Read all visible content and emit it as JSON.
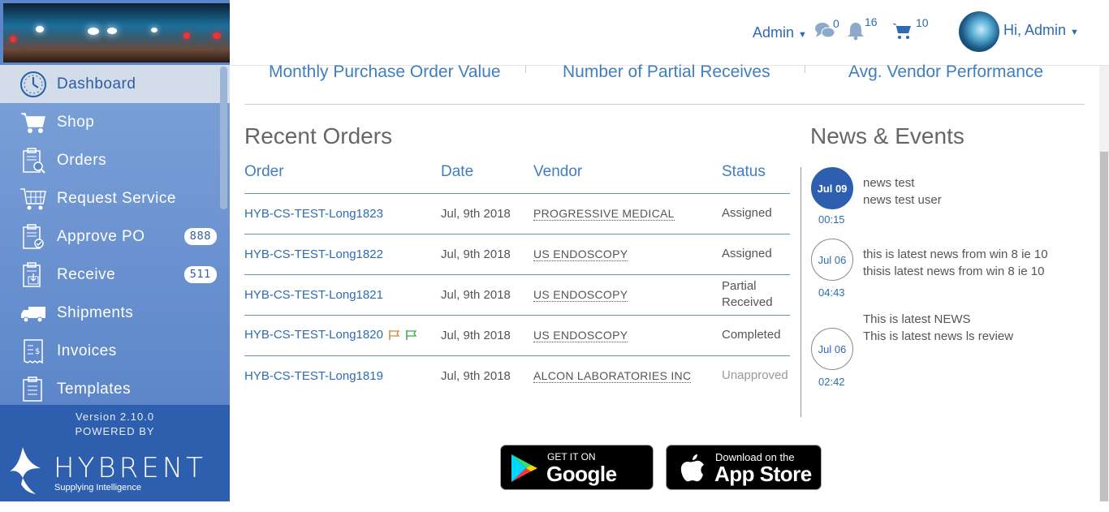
{
  "sidebar": {
    "nav": [
      {
        "label": "Dashboard",
        "icon": "dashboard-clock-icon",
        "active": true
      },
      {
        "label": "Shop",
        "icon": "shopping-cart-icon"
      },
      {
        "label": "Orders",
        "icon": "clipboard-search-icon"
      },
      {
        "label": "Request Service",
        "icon": "cart-grid-icon"
      },
      {
        "label": "Approve PO",
        "icon": "clipboard-check-icon",
        "badge": "888"
      },
      {
        "label": "Receive",
        "icon": "clipboard-download-icon",
        "badge": "511"
      },
      {
        "label": "Shipments",
        "icon": "truck-icon"
      },
      {
        "label": "Invoices",
        "icon": "invoice-icon"
      },
      {
        "label": "Templates",
        "icon": "clipboard-list-icon"
      }
    ],
    "version": "Version 2.10.0",
    "powered_by": "POWERED BY",
    "brand": "HYBRENT",
    "tagline": "Supplying Intelligence"
  },
  "header": {
    "admin_menu": "Admin",
    "messages_count": "0",
    "notifications_count": "16",
    "cart_count": "10",
    "greeting": "Hi, Admin"
  },
  "kpis": [
    "Monthly Purchase Order Value",
    "Number of Partial Receives",
    "Avg. Vendor Performance"
  ],
  "recent_orders": {
    "title": "Recent Orders",
    "columns": [
      "Order",
      "Date",
      "Vendor",
      "Status"
    ],
    "rows": [
      {
        "order": "HYB-CS-TEST-Long1823",
        "date": "Jul, 9th 2018",
        "vendor": "PROGRESSIVE MEDICAL",
        "status": "Assigned"
      },
      {
        "order": "HYB-CS-TEST-Long1822",
        "date": "Jul, 9th 2018",
        "vendor": "US ENDOSCOPY",
        "status": "Assigned"
      },
      {
        "order": "HYB-CS-TEST-Long1821",
        "date": "Jul, 9th 2018",
        "vendor": "US ENDOSCOPY",
        "status": "Partial Received"
      },
      {
        "order": "HYB-CS-TEST-Long1820",
        "date": "Jul, 9th 2018",
        "vendor": "US ENDOSCOPY",
        "status": "Completed",
        "flags": true
      },
      {
        "order": "HYB-CS-TEST-Long1819",
        "date": "Jul, 9th 2018",
        "vendor": "ALCON LABORATORIES INC",
        "status": "Unapproved"
      }
    ]
  },
  "news": {
    "title": "News & Events",
    "items": [
      {
        "date": "Jul 09",
        "time": "00:15",
        "line1": "news test",
        "line2": "news test user"
      },
      {
        "date": "Jul 06",
        "time": "04:43",
        "line1": "this is latest news from win 8 ie 10",
        "line2": "thisis latest news from win 8 ie 10"
      },
      {
        "date": "Jul 06",
        "time": "02:42",
        "line1": "This is latest NEWS",
        "line2": "This is latest news ls review"
      }
    ]
  },
  "stores": {
    "google_small": "GET IT ON",
    "google_big": "Google Play",
    "apple_small": "Download on the",
    "apple_big": "App Store"
  },
  "colors": {
    "sidebar": "#5b86c8",
    "brand_blue": "#2d5fae",
    "link": "#2f6bb0",
    "kpi": "#3f7ec0"
  }
}
